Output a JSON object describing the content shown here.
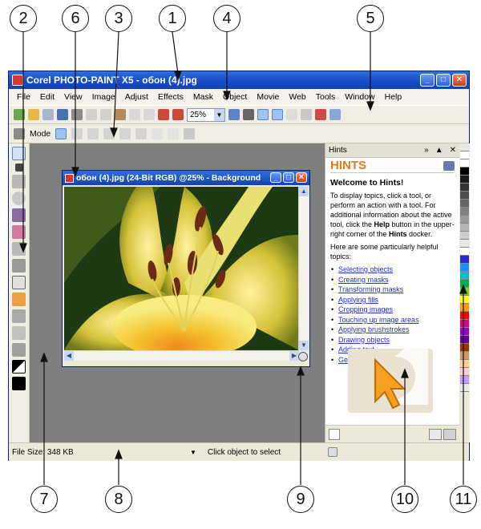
{
  "app": {
    "title": "Corel PHOTO-PAINT X5 - обон (4).jpg",
    "menu": [
      "File",
      "Edit",
      "View",
      "Image",
      "Adjust",
      "Effects",
      "Mask",
      "Object",
      "Movie",
      "Web",
      "Tools",
      "Window",
      "Help"
    ],
    "zoom": "25%",
    "mode_label": "Mode"
  },
  "document": {
    "title": "обон (4).jpg (24-Bit RGB) @25% - Background"
  },
  "docker": {
    "tab_title": "Hints",
    "heading": "HINTS",
    "welcome": "Welcome to Hints!",
    "intro_1": "To display topics, click a tool, or perform an action with a tool. For additional information about the active tool, click the ",
    "intro_help": "Help",
    "intro_2": " button in the upper-right corner of the ",
    "intro_hints": "Hints",
    "intro_3": " docker.",
    "intro_topics": "Here are some particularly helpful topics:",
    "topics": [
      "Selecting objects",
      "Creating masks",
      "Transforming masks",
      "Applying fills",
      "Cropping images",
      "Touching up image areas",
      "Applying brushstrokes",
      "Drawing objects",
      "Adding text",
      "Getting help"
    ]
  },
  "status": {
    "file_size": "File Size: 348 KB",
    "message": "Click object to select"
  },
  "callouts": [
    "1",
    "2",
    "3",
    "4",
    "5",
    "6",
    "7",
    "8",
    "9",
    "10",
    "11"
  ],
  "colors": {
    "titlebar": "#1a4fc7",
    "workspace": "#7f7f7f",
    "hints_orange": "#e87a1a",
    "link_blue": "#2233cc"
  }
}
